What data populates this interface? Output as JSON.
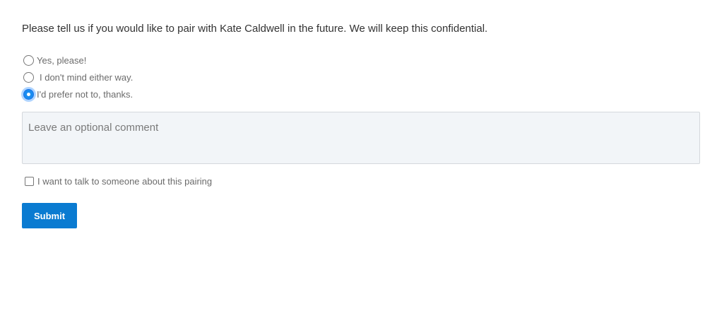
{
  "question": "Please tell us if you would like to pair with Kate Caldwell in the future. We will keep this confidential.",
  "options": [
    {
      "label": "Yes, please!",
      "checked": false
    },
    {
      "label": "I don't mind either way.",
      "checked": false
    },
    {
      "label": "I'd prefer not to, thanks.",
      "checked": true
    }
  ],
  "comment": {
    "placeholder": "Leave an optional comment",
    "value": ""
  },
  "talk_checkbox": {
    "label": "I want to talk to someone about this pairing",
    "checked": false
  },
  "submit": {
    "label": "Submit"
  },
  "colors": {
    "accent": "#0a7bd1",
    "selected_radio": "#1a8cf0",
    "comment_background": "#f2f5f8"
  }
}
